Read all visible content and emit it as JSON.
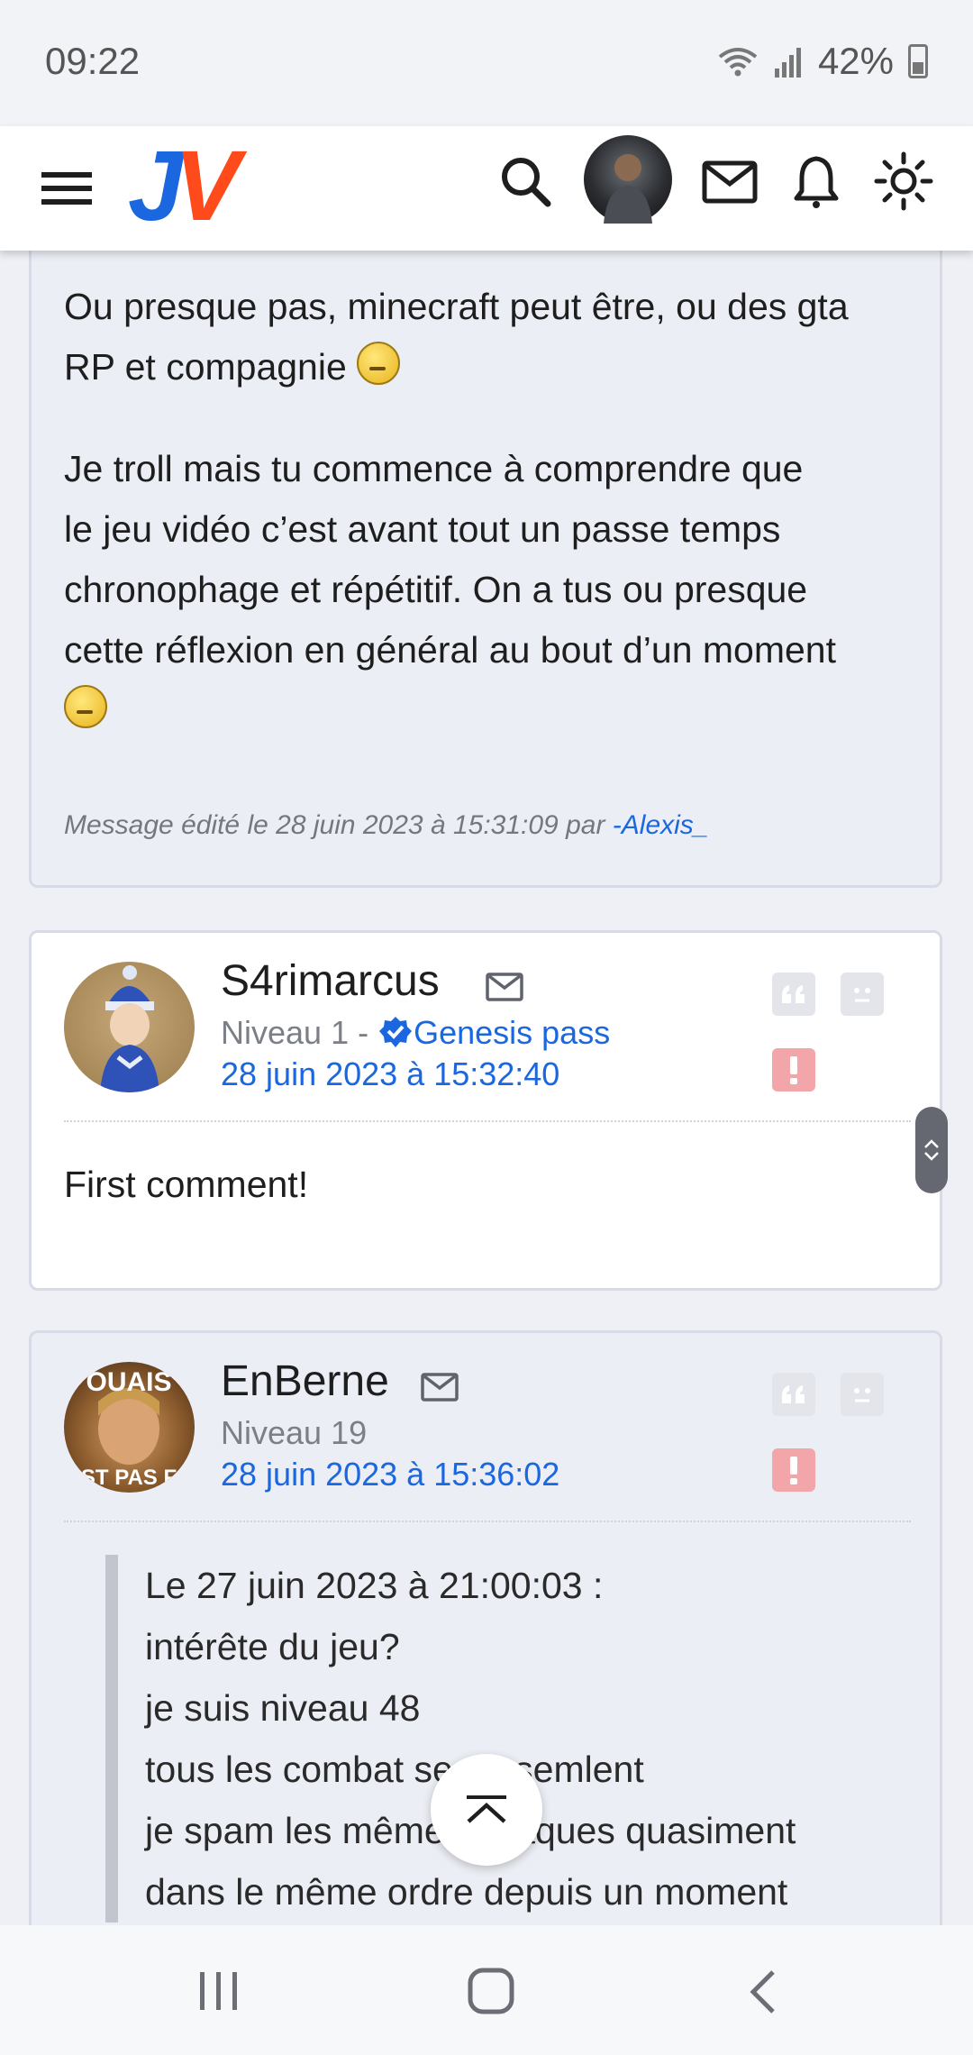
{
  "status_bar": {
    "time": "09:22",
    "battery": "42%"
  },
  "header": {
    "logo_j": "J",
    "logo_v": "V",
    "icons": [
      "menu-icon",
      "search-icon",
      "user-avatar",
      "mail-icon",
      "bell-icon",
      "theme-sun-icon"
    ]
  },
  "post1": {
    "paragraph1_line1": "Ou presque pas, minecraft peut être, ou des gta",
    "paragraph1_line2": "RP et compagnie",
    "paragraph2_lines": [
      "Je troll mais tu commence à comprendre que",
      "le jeu vidéo c’est avant tout un passe temps",
      "chronophage et répétitif. On a tus ou presque",
      "cette réflexion en général au bout d’un moment"
    ],
    "edited_prefix": "Message édité le 28 juin 2023 à 15:31:09 par ",
    "edited_author": "-Alexis_"
  },
  "post2": {
    "author": "S4rimarcus",
    "level": "Niveau 1 - ",
    "badge": "Genesis pass",
    "date": "28 juin 2023 à 15:32:40",
    "message": "First comment!"
  },
  "post3": {
    "author": "EnBerne",
    "level": "Niveau 19",
    "date": "28 juin 2023 à 15:36:02",
    "avatar_text_top": "OUAIS",
    "avatar_text_bottom": "EST PAS FA",
    "quote_lines": [
      "Le 27 juin 2023 à 21:00:03 :",
      "intérête du jeu?",
      "je suis niveau 48",
      "tous les combat se ressemlent",
      "je spam les mêmes attaques quasiment",
      "dans le même ordre depuis un moment"
    ]
  },
  "colors": {
    "accent": "#1a67e0",
    "logo_orange": "#ff4a1c",
    "report": "#f2a6a9"
  }
}
